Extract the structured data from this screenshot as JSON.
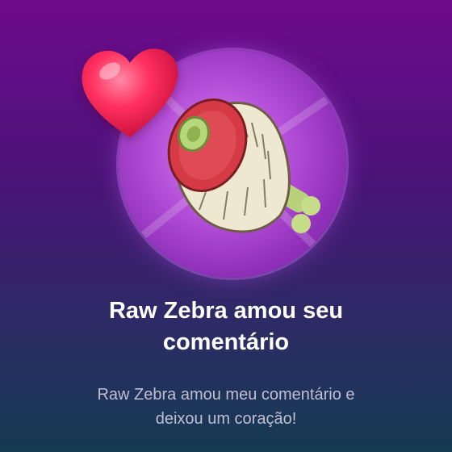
{
  "notification": {
    "title_line1": "Raw Zebra amou seu",
    "title_line2": "comentário",
    "body_line1": "Raw Zebra amou meu comentário e",
    "body_line2": "deixou um coração!"
  },
  "icons": {
    "avatar": "raw-zebra-meat-avatar-icon",
    "reaction": "heart-icon"
  },
  "colors": {
    "background_top": "#6e0a8c",
    "background_bottom": "#143a52",
    "heart": "#ff2a5c",
    "avatar_glow": "#b44fd8"
  }
}
